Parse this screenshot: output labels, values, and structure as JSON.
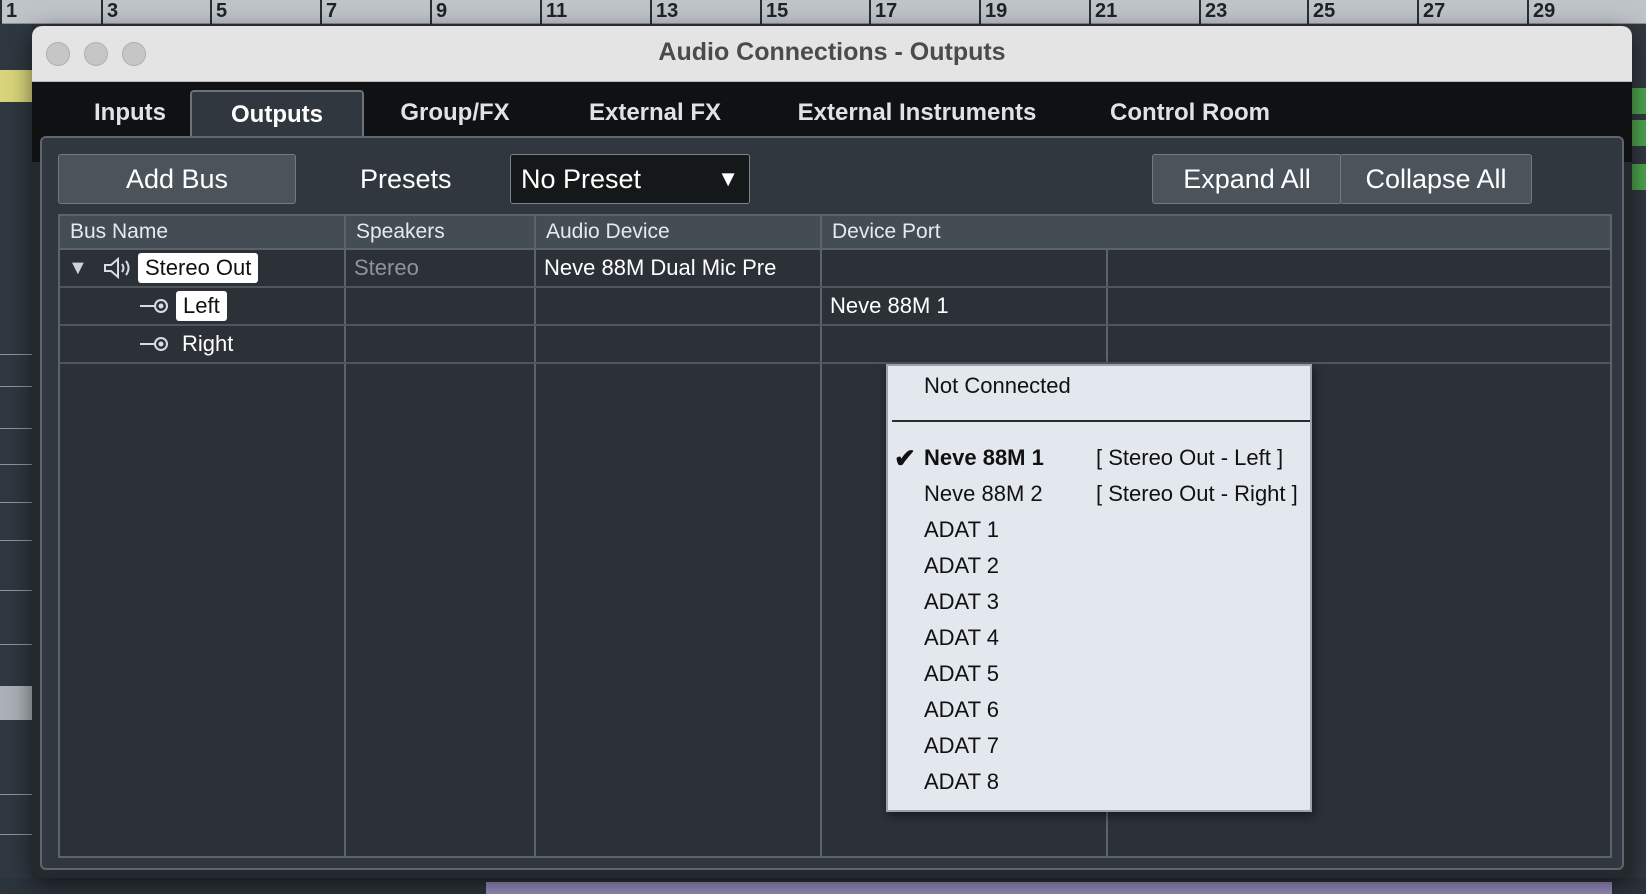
{
  "ruler": {
    "marks": [
      "1",
      "3",
      "5",
      "7",
      "9",
      "11",
      "13",
      "15",
      "17",
      "19",
      "21",
      "23",
      "25",
      "27",
      "29"
    ]
  },
  "window": {
    "title": "Audio Connections - Outputs"
  },
  "tabs": [
    {
      "label": "Inputs",
      "active": false
    },
    {
      "label": "Outputs",
      "active": true
    },
    {
      "label": "Group/FX",
      "active": false
    },
    {
      "label": "External FX",
      "active": false
    },
    {
      "label": "External Instruments",
      "active": false
    },
    {
      "label": "Control Room",
      "active": false
    }
  ],
  "toolbar": {
    "add_bus_label": "Add Bus",
    "presets_label": "Presets",
    "preset_value": "No Preset",
    "expand_all_label": "Expand All",
    "collapse_all_label": "Collapse All"
  },
  "table": {
    "columns": [
      "Bus Name",
      "Speakers",
      "Audio Device",
      "Device Port"
    ],
    "rows": [
      {
        "name": "Stereo Out",
        "speakers": "Stereo",
        "device": "Neve 88M Dual Mic Pre",
        "port": ""
      },
      {
        "name": "Left",
        "speakers": "",
        "device": "",
        "port": "Neve 88M 1"
      },
      {
        "name": "Right",
        "speakers": "",
        "device": "",
        "port": ""
      }
    ]
  },
  "port_menu": {
    "not_connected": "Not Connected",
    "items": [
      {
        "label": "Neve 88M 1",
        "assignment": "[ Stereo Out - Left ]",
        "checked": true
      },
      {
        "label": "Neve 88M 2",
        "assignment": "[ Stereo Out - Right ]",
        "checked": false
      },
      {
        "label": "ADAT 1",
        "assignment": "",
        "checked": false
      },
      {
        "label": "ADAT 2",
        "assignment": "",
        "checked": false
      },
      {
        "label": "ADAT 3",
        "assignment": "",
        "checked": false
      },
      {
        "label": "ADAT 4",
        "assignment": "",
        "checked": false
      },
      {
        "label": "ADAT 5",
        "assignment": "",
        "checked": false
      },
      {
        "label": "ADAT 6",
        "assignment": "",
        "checked": false
      },
      {
        "label": "ADAT 7",
        "assignment": "",
        "checked": false
      },
      {
        "label": "ADAT 8",
        "assignment": "",
        "checked": false
      }
    ],
    "check_glyph": "✔"
  },
  "icons": {
    "speaker": "speaker-icon",
    "output_port": "output-port-icon",
    "expander": "▼",
    "dropdown_arrow": "▼"
  }
}
